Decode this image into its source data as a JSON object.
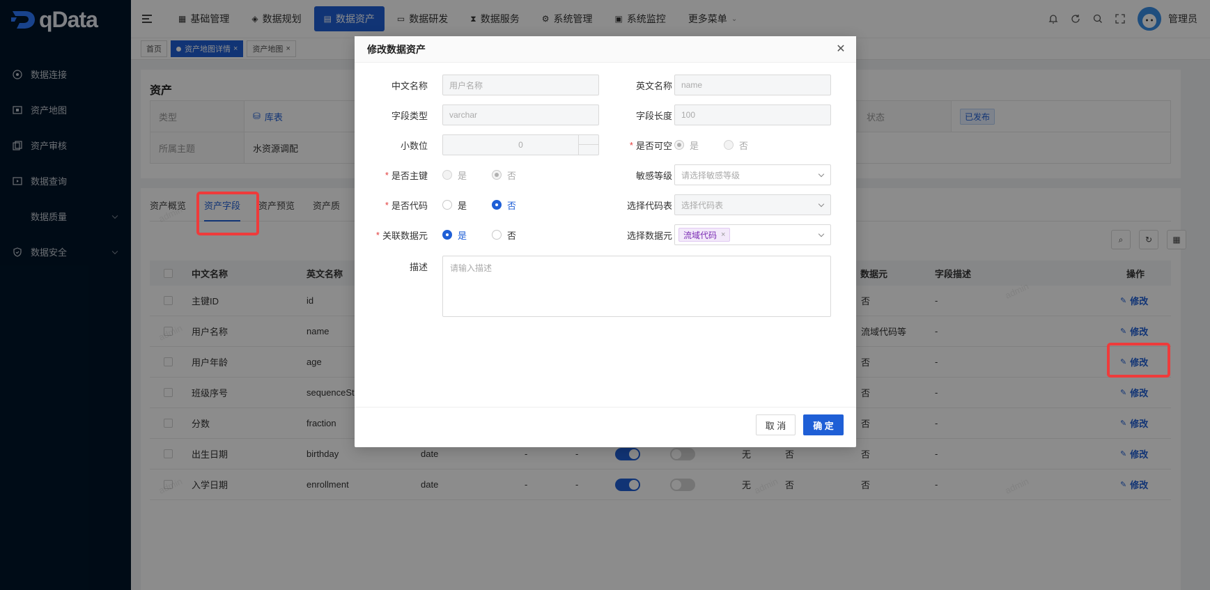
{
  "brand": {
    "name": "qData"
  },
  "sidebar": {
    "items": [
      {
        "label": "数据连接",
        "icon": "target-icon"
      },
      {
        "label": "资产地图",
        "icon": "map-icon"
      },
      {
        "label": "资产审核",
        "icon": "copy-icon"
      },
      {
        "label": "数据查询",
        "icon": "query-icon"
      },
      {
        "label": "数据质量",
        "icon": "",
        "has_children": true
      },
      {
        "label": "数据安全",
        "icon": "shield-icon",
        "has_children": true
      }
    ]
  },
  "topnav": {
    "items": [
      {
        "label": "基础管理",
        "icon": "grid-icon"
      },
      {
        "label": "数据规划",
        "icon": "layers-icon"
      },
      {
        "label": "数据资产",
        "icon": "asset-icon",
        "active": true
      },
      {
        "label": "数据研发",
        "icon": "window-icon"
      },
      {
        "label": "数据服务",
        "icon": "hourglass-icon"
      },
      {
        "label": "系统管理",
        "icon": "settings-icon"
      },
      {
        "label": "系统监控",
        "icon": "monitor-icon"
      },
      {
        "label": "更多菜单",
        "icon": "chevron-down-icon"
      }
    ],
    "user_name": "管理员"
  },
  "tags": [
    {
      "label": "首页"
    },
    {
      "label": "资产地图详情",
      "active": true
    },
    {
      "label": "资产地图"
    }
  ],
  "asset": {
    "title": "资产",
    "type_label": "类型",
    "type_value": "库表",
    "status_label": "状态",
    "status_value": "已发布",
    "theme_label": "所属主题",
    "theme_value": "水资源调配"
  },
  "fields_tabs": [
    "资产概览",
    "资产字段",
    "资产预览",
    "资产质"
  ],
  "table": {
    "headers": {
      "cn_name": "中文名称",
      "en_name": "英文名称",
      "meta": "数据元",
      "desc": "字段描述",
      "ops": "操作"
    },
    "edit_label": "修改",
    "rows": [
      {
        "cn": "主键ID",
        "en": "id",
        "type": "",
        "a": "",
        "b": "",
        "null_on": null,
        "c": "",
        "d": "",
        "meta": "否",
        "desc": "-"
      },
      {
        "cn": "用户名称",
        "en": "name",
        "type": "",
        "a": "",
        "b": "",
        "null_on": null,
        "c": "",
        "d": "",
        "meta": "流域代码等",
        "desc": "-"
      },
      {
        "cn": "用户年龄",
        "en": "age",
        "type": "",
        "a": "",
        "b": "",
        "null_on": null,
        "c": "",
        "d": "",
        "meta": "否",
        "desc": "-"
      },
      {
        "cn": "班级序号",
        "en": "sequenceSt",
        "type": "",
        "a": "",
        "b": "",
        "null_on": null,
        "c": "",
        "d": "",
        "meta": "否",
        "desc": "-"
      },
      {
        "cn": "分数",
        "en": "fraction",
        "type": "",
        "a": "",
        "b": "",
        "null_on": null,
        "c": "",
        "d": "",
        "meta": "否",
        "desc": "-"
      },
      {
        "cn": "出生日期",
        "en": "birthday",
        "type": "date",
        "a": "-",
        "b": "-",
        "null_on": true,
        "c": "无",
        "d": "否",
        "meta": "否",
        "desc": "-"
      },
      {
        "cn": "入学日期",
        "en": "enrollment",
        "type": "date",
        "a": "-",
        "b": "-",
        "null_on": true,
        "c": "无",
        "d": "否",
        "meta": "否",
        "desc": "-"
      }
    ]
  },
  "watermark_text": "admin",
  "modal": {
    "title": "修改数据资产",
    "cn_name_label": "中文名称",
    "cn_name_placeholder": "用户名称",
    "en_name_label": "英文名称",
    "en_name_placeholder": "name",
    "field_type_label": "字段类型",
    "field_type_value": "varchar",
    "field_len_label": "字段长度",
    "field_len_value": "100",
    "decimal_label": "小数位",
    "decimal_value": "0",
    "nullable_label": "是否可空",
    "pk_label": "是否主键",
    "sensitivity_label": "敏感等级",
    "sensitivity_placeholder": "请选择敏感等级",
    "is_code_label": "是否代码",
    "code_table_label": "选择代码表",
    "code_table_placeholder": "选择代码表",
    "link_meta_label": "关联数据元",
    "meta_select_label": "选择数据元",
    "meta_chip": "流域代码",
    "desc_label": "描述",
    "desc_placeholder": "请输入描述",
    "yes": "是",
    "no": "否",
    "cancel_label": "取 消",
    "confirm_label": "确 定"
  }
}
